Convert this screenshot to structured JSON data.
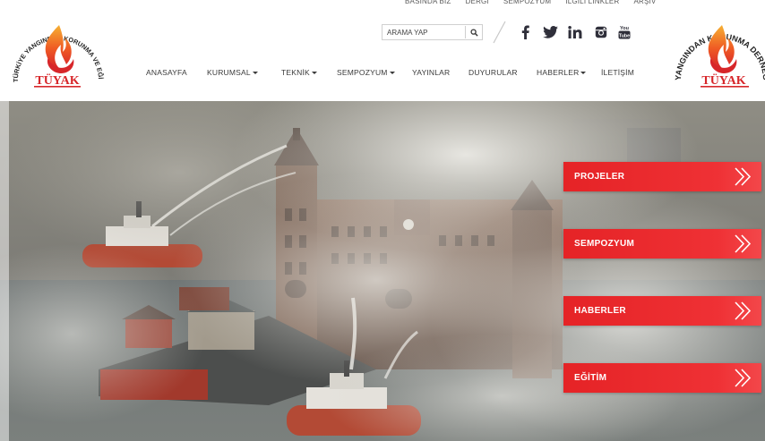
{
  "brand": {
    "name": "TÜYAK",
    "left_arc_text": "TÜRKİYE YANGINDAN KORUNMA VE EĞİTİM VAKFI",
    "right_arc_text": "YANGINDAN KORUNMA DERNEĞİ"
  },
  "top_links": [
    "BASINDA BİZ",
    "DERGİ",
    "SEMPOZYUM",
    "İLGİLİ LİNKLER",
    "ARŞİV"
  ],
  "search": {
    "placeholder": "ARAMA YAP",
    "icon": "search-icon"
  },
  "social": [
    "facebook-icon",
    "twitter-icon",
    "linkedin-icon",
    "instagram-icon",
    "youtube-icon"
  ],
  "nav": [
    {
      "label": "ANASAYFA",
      "dropdown": false
    },
    {
      "label": "KURUMSAL",
      "dropdown": true
    },
    {
      "label": "TEKNİK",
      "dropdown": true
    },
    {
      "label": "SEMPOZYUM",
      "dropdown": true
    },
    {
      "label": "YAYINLAR",
      "dropdown": false
    },
    {
      "label": "DUYURULAR",
      "dropdown": false
    },
    {
      "label": "HABERLER",
      "dropdown": true
    },
    {
      "label": "İLETİŞİM",
      "dropdown": false
    }
  ],
  "hero_tiles": [
    {
      "label": "PROJELER"
    },
    {
      "label": "SEMPOZYUM"
    },
    {
      "label": "HABERLER"
    },
    {
      "label": "EĞİTİM"
    }
  ],
  "colors": {
    "accent": "#ec2d31",
    "brand_red": "#d7262a",
    "flame_yellow": "#f6b133"
  }
}
